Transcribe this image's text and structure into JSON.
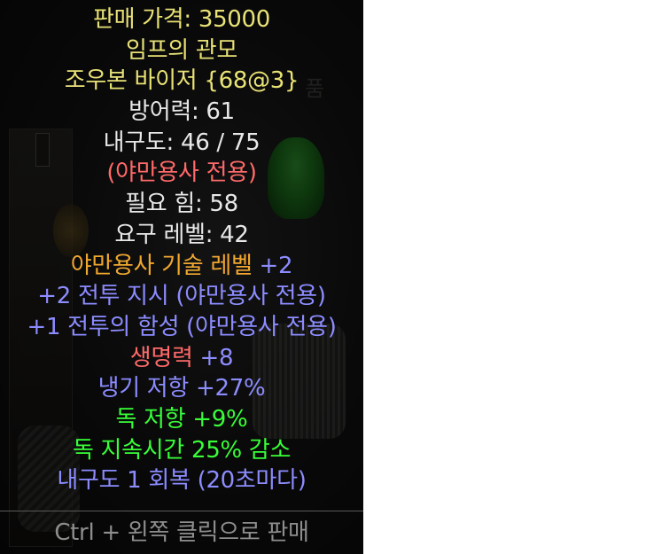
{
  "colors": {
    "gold": "#e8e276",
    "white": "#e8e8e8",
    "red": "#ff6a6a",
    "orange": "#f0a830",
    "blue": "#8c8cff",
    "green": "#38ff38",
    "gray": "#8e8e8e"
  },
  "background": {
    "ghost_text": "품"
  },
  "tooltip": {
    "price": "판매 가격: 35000",
    "item_name": "임프의 관모",
    "base_type": "조우본 바이저 {68@3}",
    "defense": "방어력: 61",
    "durability": "내구도: 46 / 75",
    "class_only": "(야만용사 전용)",
    "req_str": "필요 힘: 58",
    "req_level": "요구 레벨: 42",
    "skill_label": "야만용사 기술 레벨",
    "skill_value": " +2",
    "battle_orders": "+2 전투 지시 (야만용사 전용)",
    "battle_cry": "+1 전투의 함성 (야만용사 전용)",
    "life_label": "생명력",
    "life_value": " +8",
    "cold_res": "냉기 저항 +27%",
    "poison_res": "독 저항 +9%",
    "poison_len": "독 지속시간 25% 감소",
    "repair": "내구도 1 회복 (20초마다)",
    "footer": "Ctrl + 왼쪽 클릭으로 판매"
  }
}
